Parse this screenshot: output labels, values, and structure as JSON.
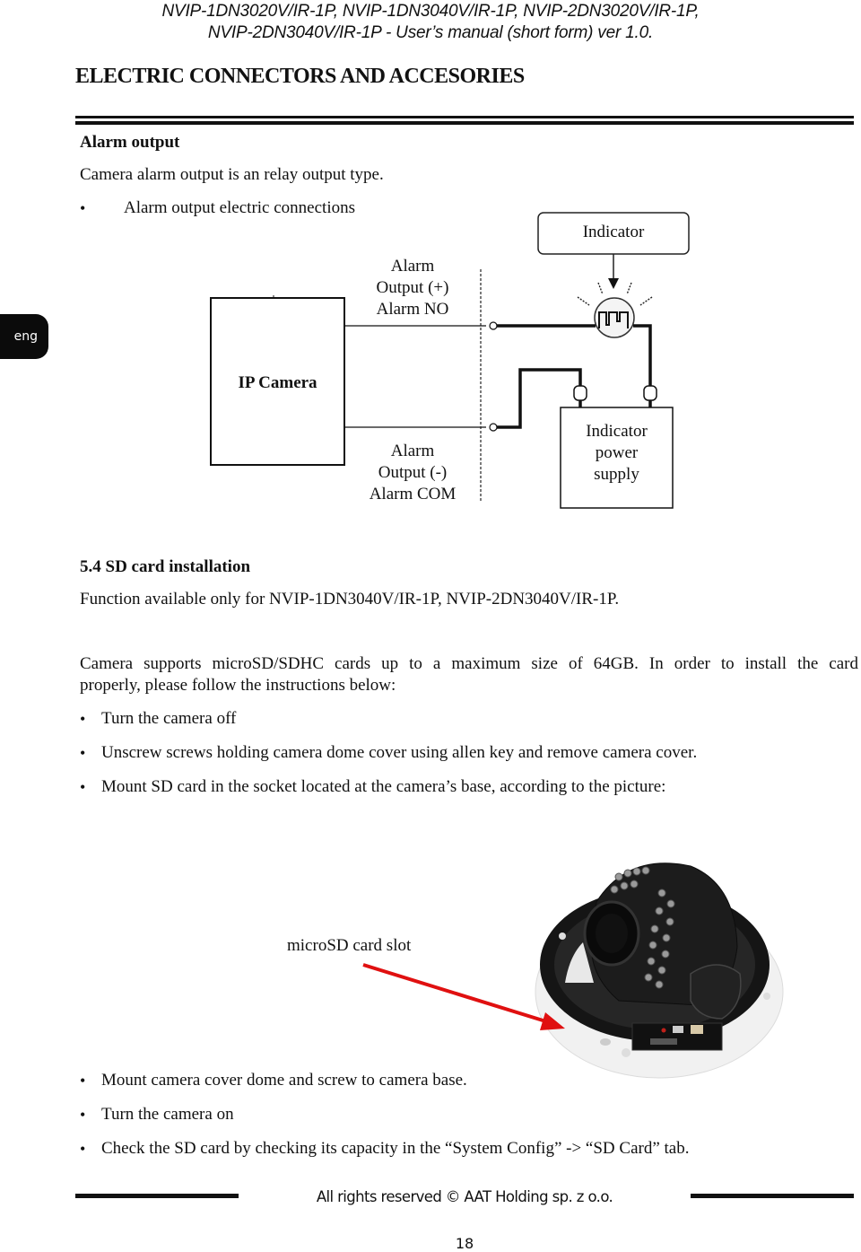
{
  "header": {
    "line1": "NVIP-1DN3020V/IR-1P, NVIP-1DN3040V/IR-1P, NVIP-2DN3020V/IR-1P,",
    "line2": "NVIP-2DN3040V/IR-1P - User’s manual (short form) ver 1.0."
  },
  "section_title": "ELECTRIC CONNECTORS AND ACCESORIES",
  "language_tab": "eng",
  "alarm_output": {
    "heading": "Alarm output",
    "intro": "Camera alarm output is an relay output type.",
    "bullet": "Alarm output electric connections",
    "diagram": {
      "indicator_label": "Indicator",
      "ip_camera_label": "IP Camera",
      "output_plus": [
        "Alarm",
        "Output (+)",
        "Alarm NO"
      ],
      "output_minus": [
        "Alarm",
        "Output (-)",
        "Alarm COM"
      ],
      "power_supply": [
        "Indicator",
        "power",
        "supply"
      ]
    }
  },
  "sd_card": {
    "heading": "5.4 SD card installation",
    "availability": "Function available only for NVIP-1DN3040V/IR-1P, NVIP-2DN3040V/IR-1P.",
    "support_line1": "Camera supports microSD/SDHC cards up to a maximum size of 64GB. In order to install the card",
    "support_line2": "properly, please follow the instructions below:",
    "steps_before": [
      "Turn the camera off",
      "Unscrew screws holding camera dome cover using allen key and remove camera cover.",
      "Mount SD card in the socket located at the camera’s base, according to the picture:"
    ],
    "photo_label": "microSD card slot",
    "arrow_color": "#e01010",
    "steps_after": [
      "Mount camera cover dome and screw to camera base.",
      "Turn the camera on",
      "Check the SD card by checking its capacity in the “System Config” -> “SD Card” tab."
    ]
  },
  "footer": {
    "copyright": "All rights reserved © AAT Holding sp. z o.o.",
    "page_number": "18"
  }
}
